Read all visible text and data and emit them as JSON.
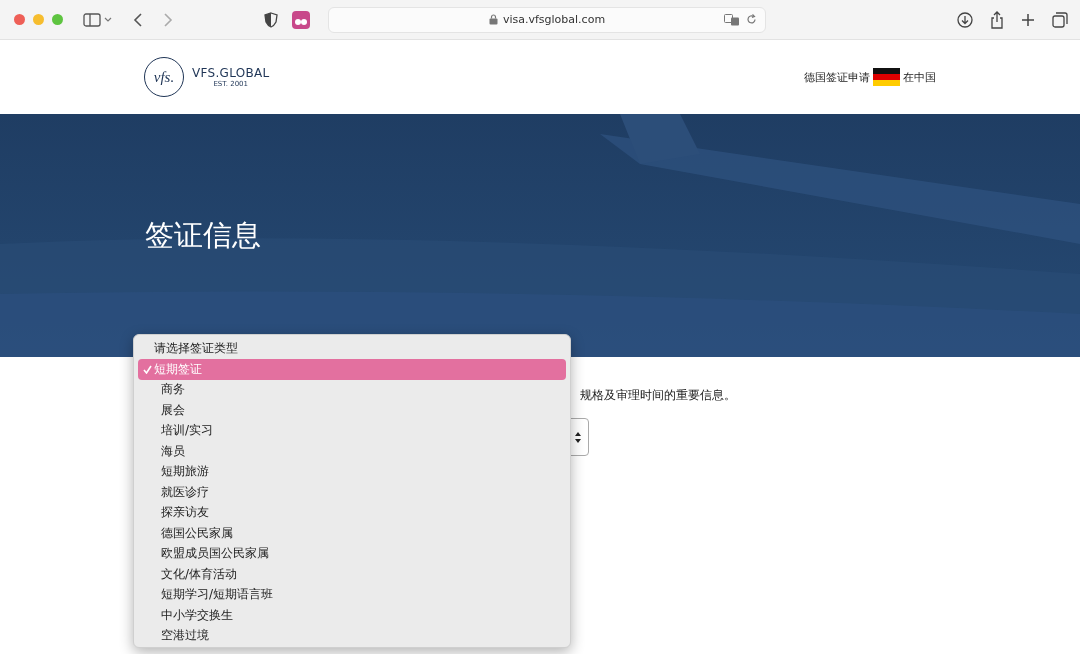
{
  "browser": {
    "url": "visa.vfsglobal.com"
  },
  "header": {
    "logo_mark": "vfs.",
    "logo_text": "VFS.GLOBAL",
    "logo_tagline": "EST. 2001",
    "locale_prefix": "德国签证申请",
    "locale_suffix": "在中国"
  },
  "hero": {
    "kind": "picture",
    "title": "签证信息"
  },
  "intro_text": "规格及审理时间的重要信息。",
  "visa_type_menu": {
    "prompt": "请选择签证类型",
    "options": [
      {
        "label": "短期签证",
        "selected": true
      },
      {
        "label": "商务",
        "selected": false
      },
      {
        "label": "展会",
        "selected": false
      },
      {
        "label": "培训/实习",
        "selected": false
      },
      {
        "label": "海员",
        "selected": false
      },
      {
        "label": "短期旅游",
        "selected": false
      },
      {
        "label": "就医诊疗",
        "selected": false
      },
      {
        "label": "探亲访友",
        "selected": false
      },
      {
        "label": "德国公民家属",
        "selected": false
      },
      {
        "label": "欧盟成员国公民家属",
        "selected": false
      },
      {
        "label": "文化/体育活动",
        "selected": false
      },
      {
        "label": "短期学习/短期语言班",
        "selected": false
      },
      {
        "label": "中小学交换生",
        "selected": false
      },
      {
        "label": "空港过境",
        "selected": false
      }
    ]
  }
}
